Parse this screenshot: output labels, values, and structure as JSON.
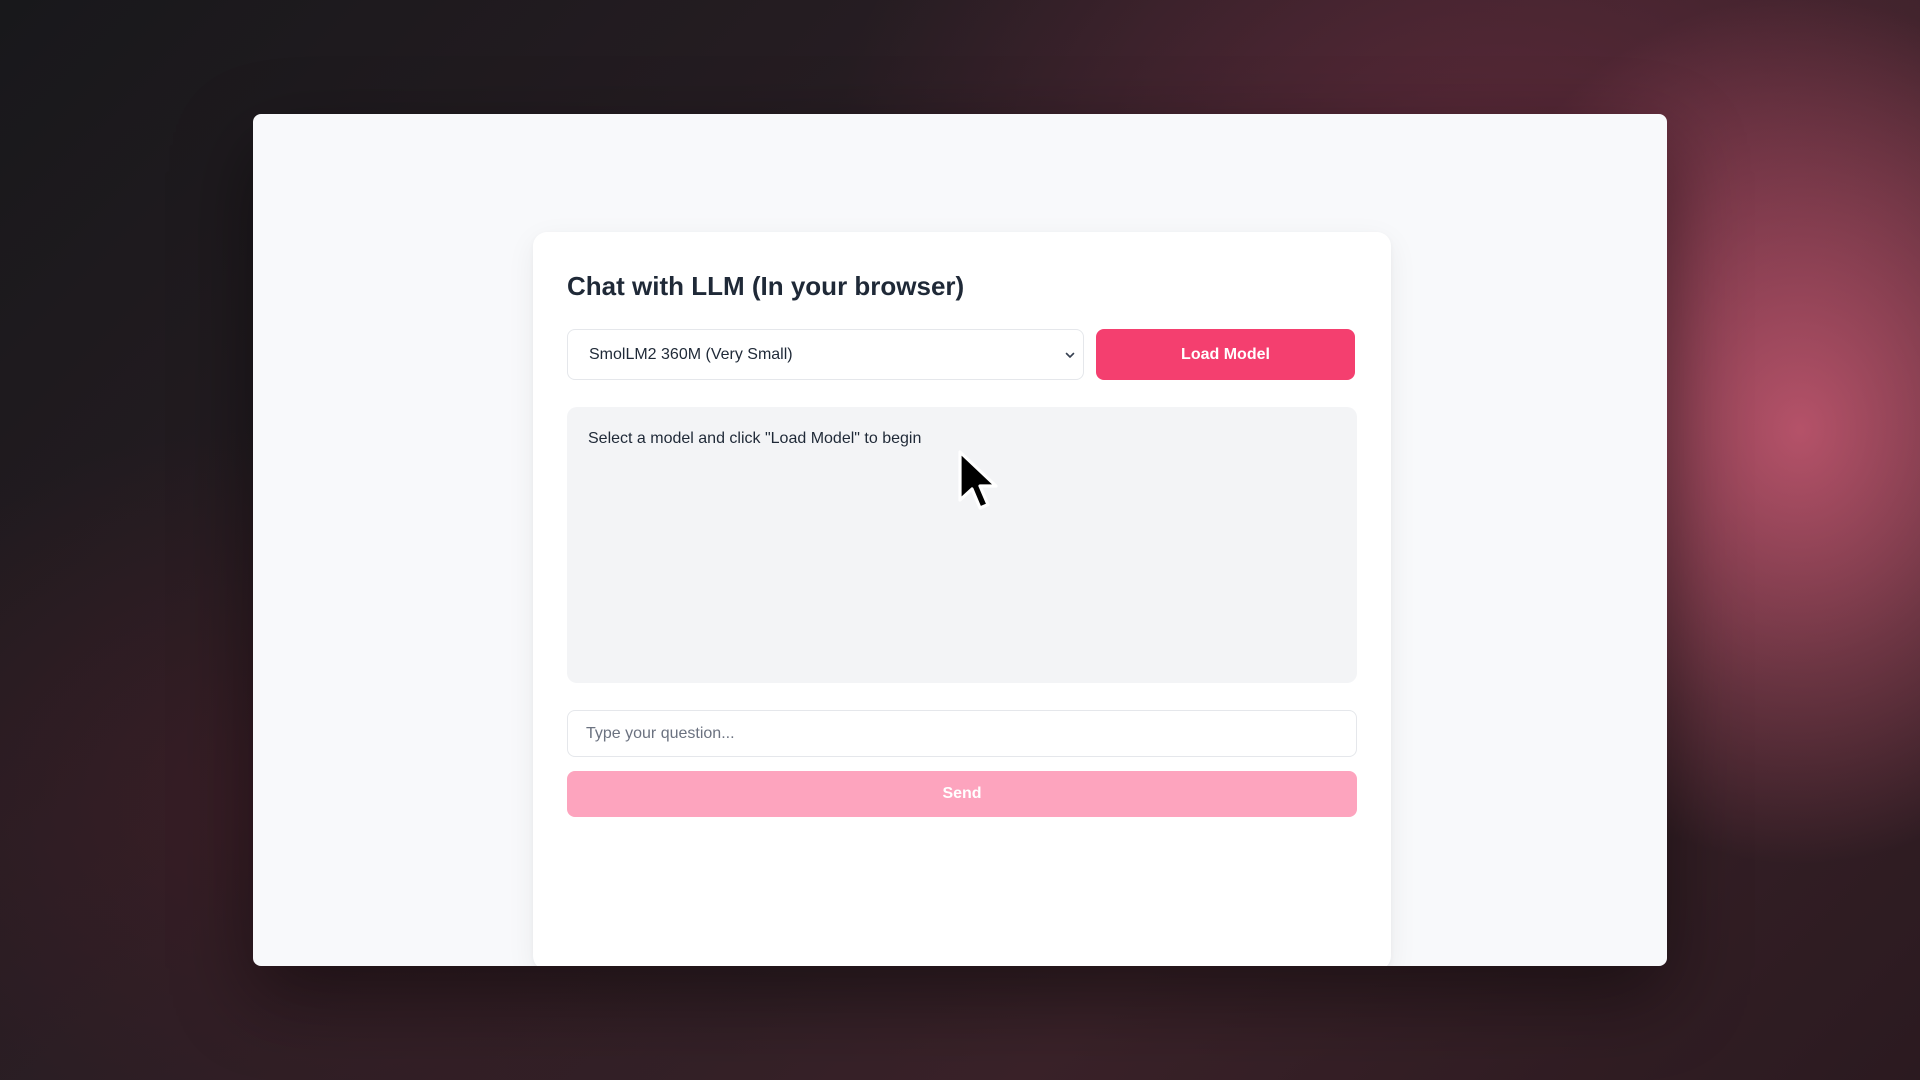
{
  "app": {
    "title": "Chat with LLM (In your browser)"
  },
  "controls": {
    "model_select": {
      "selected": "SmolLM2 360M (Very Small)",
      "icon": "chevron-down-icon"
    },
    "load_label": "Load Model"
  },
  "messages": {
    "status": "Select a model and click \"Load Model\" to begin"
  },
  "input": {
    "placeholder": "Type your question...",
    "value": ""
  },
  "send_label": "Send",
  "colors": {
    "accent": "#f43f6f",
    "accent_disabled": "#fda4be",
    "window_bg": "#f8f9fb",
    "card_bg": "#ffffff",
    "messages_bg": "#f3f4f6"
  },
  "cursor": {
    "icon": "mouse-pointer-icon"
  }
}
